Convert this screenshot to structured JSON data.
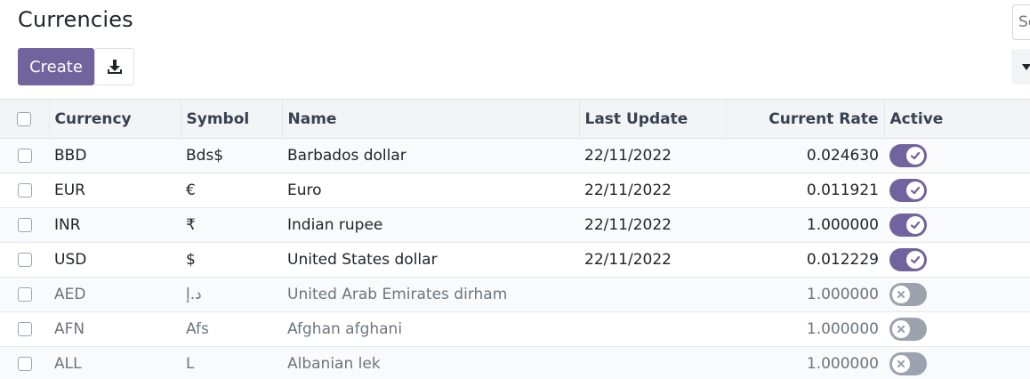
{
  "page": {
    "title": "Currencies"
  },
  "search": {
    "placeholder": "Search..."
  },
  "toolbar": {
    "create_label": "Create",
    "download_icon": "download-icon"
  },
  "filter": {
    "icon": "filter-icon"
  },
  "table": {
    "headers": {
      "currency": "Currency",
      "symbol": "Symbol",
      "name": "Name",
      "last_update": "Last Update",
      "current_rate": "Current Rate",
      "active": "Active"
    },
    "rows": [
      {
        "currency": "BBD",
        "symbol": "Bds$",
        "name": "Barbados dollar",
        "last_update": "22/11/2022",
        "current_rate": "0.024630",
        "active": true
      },
      {
        "currency": "EUR",
        "symbol": "€",
        "name": "Euro",
        "last_update": "22/11/2022",
        "current_rate": "0.011921",
        "active": true
      },
      {
        "currency": "INR",
        "symbol": "₹",
        "name": "Indian rupee",
        "last_update": "22/11/2022",
        "current_rate": "1.000000",
        "active": true
      },
      {
        "currency": "USD",
        "symbol": "$",
        "name": "United States dollar",
        "last_update": "22/11/2022",
        "current_rate": "0.012229",
        "active": true
      },
      {
        "currency": "AED",
        "symbol": "د.إ",
        "name": "United Arab Emirates dirham",
        "last_update": "",
        "current_rate": "1.000000",
        "active": false
      },
      {
        "currency": "AFN",
        "symbol": "Afs",
        "name": "Afghan afghani",
        "last_update": "",
        "current_rate": "1.000000",
        "active": false
      },
      {
        "currency": "ALL",
        "symbol": "L",
        "name": "Albanian lek",
        "last_update": "",
        "current_rate": "1.000000",
        "active": false
      }
    ]
  },
  "colors": {
    "accent": "#71639e",
    "inactive_toggle": "#9ca3af",
    "header_bg": "#f3f4f6"
  }
}
